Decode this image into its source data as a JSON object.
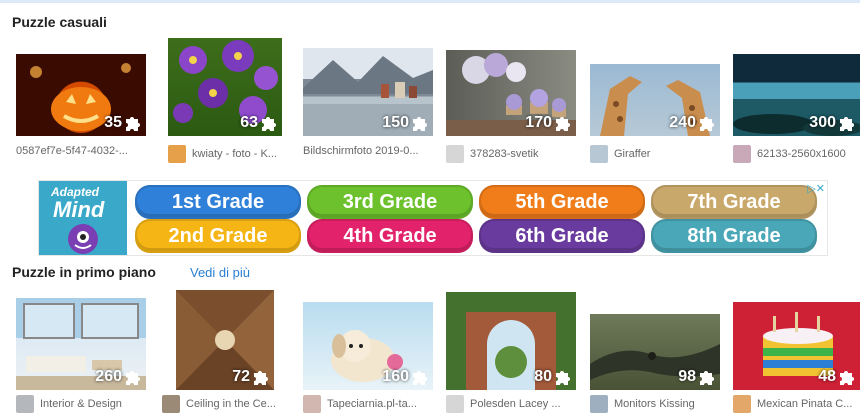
{
  "sections": {
    "casual": {
      "title": "Puzzle casuali"
    },
    "featured": {
      "title": "Puzzle in primo piano",
      "see_more": "Vedi di più"
    }
  },
  "casual_puzzles": [
    {
      "caption": "0587ef7e-5f47-4032-...",
      "pieces": "35"
    },
    {
      "caption": "kwiaty - foto - K...",
      "pieces": "63"
    },
    {
      "caption": "Bildschirmfoto 2019-0...",
      "pieces": "150"
    },
    {
      "caption": "378283-svetik",
      "pieces": "170"
    },
    {
      "caption": "Giraffer",
      "pieces": "240"
    },
    {
      "caption": "62133-2560x1600",
      "pieces": "300"
    }
  ],
  "featured_puzzles": [
    {
      "caption": "Interior & Design",
      "pieces": "260"
    },
    {
      "caption": "Ceiling in the Ce...",
      "pieces": "72"
    },
    {
      "caption": "Tapeciarnia.pl-ta...",
      "pieces": "160"
    },
    {
      "caption": "Polesden Lacey ...",
      "pieces": "80"
    },
    {
      "caption": "Monitors Kissing",
      "pieces": "98"
    },
    {
      "caption": "Mexican Pinata C...",
      "pieces": "48"
    }
  ],
  "ad": {
    "brand_line1": "Adapted",
    "brand_line2": "Mind",
    "grades": [
      {
        "label": "1st Grade",
        "color": "#2f80d9"
      },
      {
        "label": "3rd Grade",
        "color": "#6cc12c"
      },
      {
        "label": "5th Grade",
        "color": "#f07c1a"
      },
      {
        "label": "7th Grade",
        "color": "#c9a86b"
      },
      {
        "label": "2nd Grade",
        "color": "#f5b514"
      },
      {
        "label": "4th Grade",
        "color": "#e2226a"
      },
      {
        "label": "6th Grade",
        "color": "#6a3b9e"
      },
      {
        "label": "8th Grade",
        "color": "#49a7b8"
      }
    ],
    "choices_icon": "adchoices-icon"
  },
  "colors": {
    "link": "#2a7fd6",
    "section_title": "#222222",
    "caption": "#666666"
  }
}
